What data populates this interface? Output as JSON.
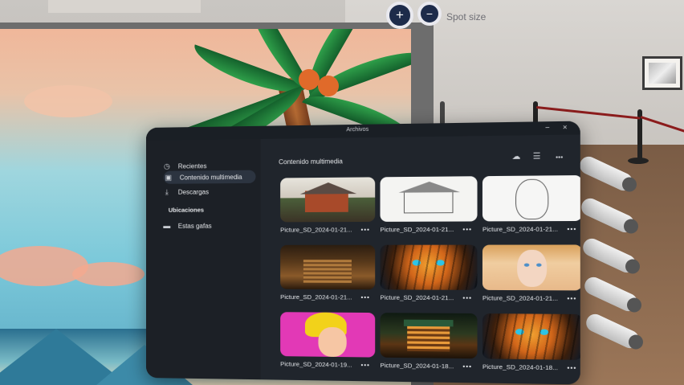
{
  "spot_control": {
    "plus_label": "+",
    "minus_label": "−",
    "label": "Spot size"
  },
  "window": {
    "title": "Archivos",
    "minimize_icon": "−",
    "close_icon": "×"
  },
  "sidebar": {
    "items": [
      {
        "label": "Recientes",
        "icon": "clock-icon",
        "active": false
      },
      {
        "label": "Contenido multimedia",
        "icon": "media-icon",
        "active": true
      },
      {
        "label": "Descargas",
        "icon": "download-icon",
        "active": false
      }
    ],
    "locations_heading": "Ubicaciones",
    "locations": [
      {
        "label": "Estas gafas",
        "icon": "folder-icon"
      }
    ]
  },
  "content": {
    "title": "Contenido multimedia",
    "tools": {
      "cloud_icon": "cloud-icon",
      "filter_icon": "sliders-icon",
      "more_icon": "more-icon"
    },
    "files": [
      {
        "name": "Picture_SD_2024-01-21...",
        "art": "cabin-red"
      },
      {
        "name": "Picture_SD_2024-01-21...",
        "art": "cabin-sketch"
      },
      {
        "name": "Picture_SD_2024-01-21...",
        "art": "face-sketch"
      },
      {
        "name": "Picture_SD_2024-01-21...",
        "art": "cabin-brown"
      },
      {
        "name": "Picture_SD_2024-01-21...",
        "art": "tiger"
      },
      {
        "name": "Picture_SD_2024-01-21...",
        "art": "blonde"
      },
      {
        "name": "Picture_SD_2024-01-19...",
        "art": "girl"
      },
      {
        "name": "Picture_SD_2024-01-18...",
        "art": "cabin-night"
      },
      {
        "name": "Picture_SD_2024-01-18...",
        "art": "tiger"
      }
    ],
    "more_label": "•••"
  }
}
